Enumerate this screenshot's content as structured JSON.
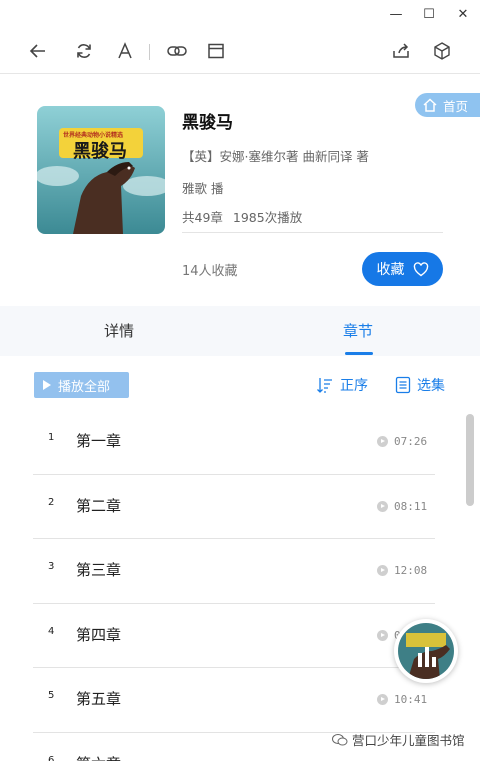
{
  "window": {
    "minimize": "—",
    "maximize": "☐",
    "close": "✕"
  },
  "toolbar": {
    "icons": [
      "back-icon",
      "refresh-icon",
      "font-icon",
      "link-icon",
      "window-icon",
      "share-icon",
      "cube-icon"
    ]
  },
  "home_button": {
    "label": "首页"
  },
  "book": {
    "cover_title": "黑骏马",
    "cover_top_text": "世界经典动物小说精选",
    "title": "黑骏马",
    "author": "【英】安娜·塞维尔著 曲新同译 著",
    "narrator": "雅歌 播",
    "chapters_count": "共49章",
    "plays": "1985次播放",
    "favorites": "14人收藏",
    "fav_button": "收藏"
  },
  "tabs": [
    {
      "label": "详情",
      "active": false
    },
    {
      "label": "章节",
      "active": true
    }
  ],
  "actions": {
    "play_all": "播放全部",
    "sort": "正序",
    "select": "选集"
  },
  "chapters": [
    {
      "num": "1",
      "title": "第一章",
      "duration": "07:26"
    },
    {
      "num": "2",
      "title": "第二章",
      "duration": "08:11"
    },
    {
      "num": "3",
      "title": "第三章",
      "duration": "12:08"
    },
    {
      "num": "4",
      "title": "第四章",
      "duration": "0"
    },
    {
      "num": "5",
      "title": "第五章",
      "duration": "10:41"
    },
    {
      "num": "6",
      "title": "第六章",
      "duration": ""
    }
  ],
  "watermark": "营口少年儿童图书馆",
  "colors": {
    "accent": "#1a7ee8",
    "fav_button": "#1678e6",
    "play_all": "#93c1ee",
    "home": "#8fc3f0"
  }
}
